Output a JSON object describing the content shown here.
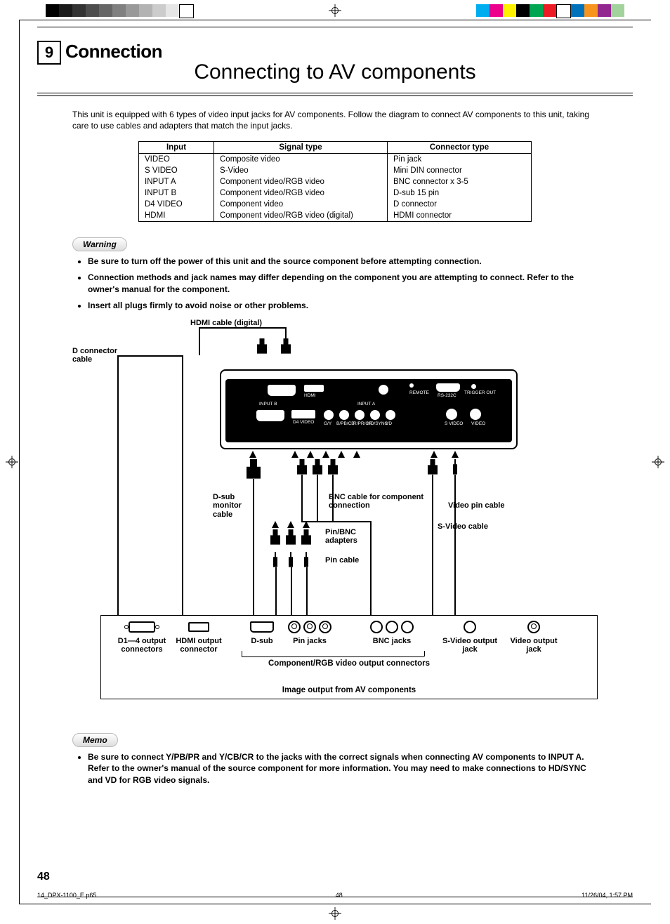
{
  "section": {
    "number": "9",
    "title": "Connection"
  },
  "subtitle": "Connecting to AV components",
  "intro": "This unit is equipped with 6 types of video input jacks for AV components. Follow the diagram to connect AV components to this unit, taking care to use cables and adapters that match the input jacks.",
  "table": {
    "headers": [
      "Input",
      "Signal type",
      "Connector type"
    ],
    "rows": [
      [
        "VIDEO",
        "Composite video",
        "Pin jack"
      ],
      [
        "S VIDEO",
        "S-Video",
        "Mini DIN connector"
      ],
      [
        "INPUT A",
        "Component video/RGB video",
        "BNC connector x 3-5"
      ],
      [
        "INPUT B",
        "Component video/RGB video",
        "D-sub 15 pin"
      ],
      [
        "D4 VIDEO",
        "Component video",
        "D connector"
      ],
      [
        "HDMI",
        "Component video/RGB video (digital)",
        "HDMI connector"
      ]
    ]
  },
  "warning": {
    "label": "Warning",
    "items": [
      "Be sure to turn off the power of this unit and the source component before attempting connection.",
      "Connection methods and jack names may differ depending on the component you are attempting to connect. Refer to the owner's manual for the component.",
      "Insert all plugs firmly to avoid noise or other problems."
    ]
  },
  "diagram": {
    "labels": {
      "hdmi_cable": "HDMI cable (digital)",
      "d_connector_cable": "D connector cable",
      "dsub_monitor_cable": "D-sub monitor cable",
      "bnc_cable": "BNC cable for component connection",
      "video_pin_cable": "Video pin cable",
      "svideo_cable": "S-Video cable",
      "pin_bnc_adapters": "Pin/BNC adapters",
      "pin_cable": "Pin cable"
    },
    "panel_ports": {
      "input_b": "INPUT B",
      "hdmi": "HDMI",
      "input_a": "INPUT A",
      "d4_video": "D4 VIDEO",
      "remote": "REMOTE",
      "rs232c": "RS-232C",
      "trigger_out": "TRIGGER OUT",
      "svideo": "S VIDEO",
      "video": "VIDEO",
      "gy": "G/Y",
      "bpbcb": "B/PB/CB",
      "rprcr": "R/PR/CR",
      "hdsync": "HD/SYNC",
      "vd": "VD"
    },
    "av_box": {
      "jacks": [
        {
          "name": "d4",
          "label_l1": "D1—4 output",
          "label_l2": "connectors"
        },
        {
          "name": "hdmi",
          "label_l1": "HDMI output",
          "label_l2": "connector"
        },
        {
          "name": "dsub",
          "label_l1": "D-sub",
          "label_l2": ""
        },
        {
          "name": "pin",
          "label_l1": "Pin jacks",
          "label_l2": ""
        },
        {
          "name": "bnc",
          "label_l1": "BNC jacks",
          "label_l2": ""
        },
        {
          "name": "svideo",
          "label_l1": "S-Video output",
          "label_l2": "jack"
        },
        {
          "name": "video",
          "label_l1": "Video output",
          "label_l2": "jack"
        }
      ],
      "mid": "Component/RGB video output connectors",
      "bottom": "Image output from AV components"
    }
  },
  "memo": {
    "label": "Memo",
    "items": [
      "Be sure to connect Y/PB/PR and Y/CB/CR to the jacks with the correct signals when connecting AV components to INPUT A. Refer to the owner's manual of the source component for more information. You may need to make connections to HD/SYNC and VD for RGB video signals."
    ]
  },
  "page_number": "48",
  "footer": {
    "file": "14_DPX-1100_E.p65",
    "page": "48",
    "date": "11/26/04, 1:57 PM"
  },
  "colorbar_left": [
    "#000",
    "#1a1a1a",
    "#333",
    "#4d4d4d",
    "#666",
    "#808080",
    "#999",
    "#b3b3b3",
    "#ccc",
    "#e6e6e6",
    "#fff"
  ],
  "colorbar_right": [
    "#00aeef",
    "#ec008c",
    "#fff200",
    "#000",
    "#00a651",
    "#ed1c24",
    "#fff",
    "#0072bc",
    "#f7941d",
    "#92278f",
    "#a3d39c"
  ]
}
